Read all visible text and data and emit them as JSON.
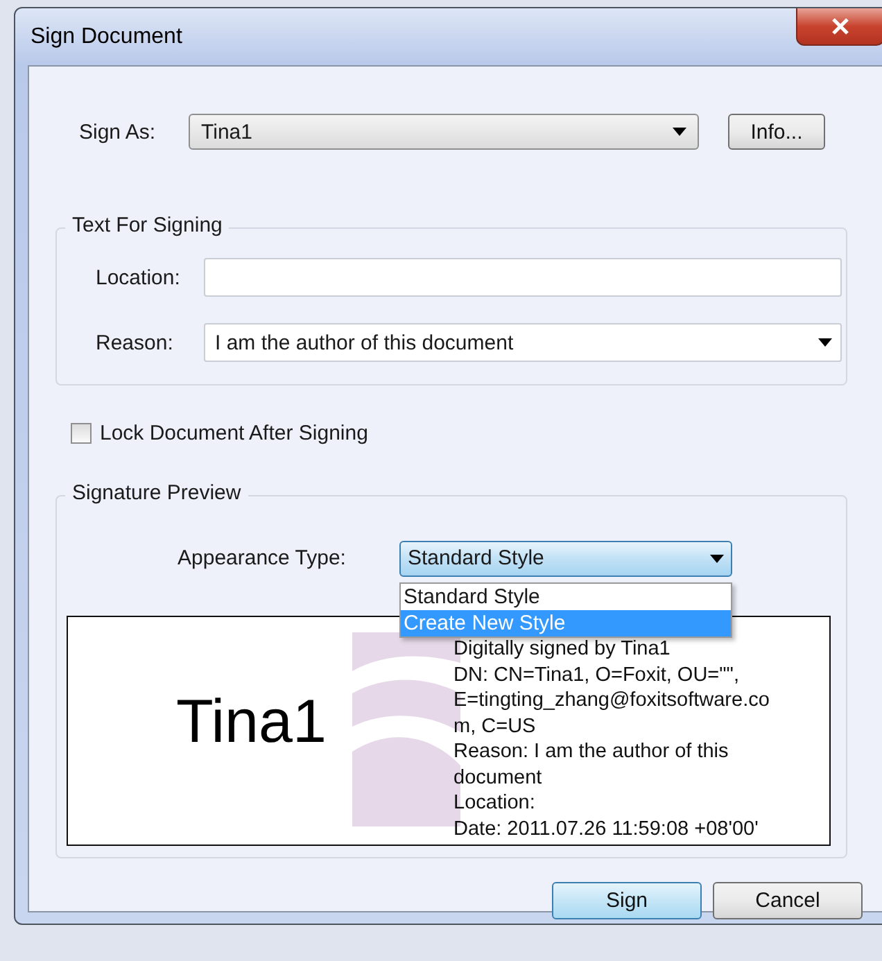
{
  "window": {
    "title": "Sign Document"
  },
  "sign_as": {
    "label": "Sign As:",
    "value": "Tina1",
    "info_button": "Info..."
  },
  "text_for_signing": {
    "title": "Text For Signing",
    "location": {
      "label": "Location:"
    },
    "reason": {
      "label": "Reason:",
      "value": "I am the author of this document"
    }
  },
  "lock_checkbox": {
    "label": "Lock Document After Signing",
    "checked": false
  },
  "signature_preview": {
    "title": "Signature Preview",
    "appearance_type": {
      "label": "Appearance Type:",
      "value": "Standard Style",
      "expanded": true,
      "options": [
        {
          "label": "Standard Style",
          "highlighted": false
        },
        {
          "label": "Create New Style",
          "highlighted": true
        }
      ]
    },
    "preview": {
      "name": "Tina1",
      "lines": [
        "Digitally signed by Tina1",
        "DN: CN=Tina1, O=Foxit, OU=\"\",",
        "E=tingting_zhang@foxitsoftware.co",
        "m, C=US",
        "Reason: I am the author of this",
        "document",
        "Location:",
        "Date: 2011.07.26 11:59:08 +08'00'"
      ]
    }
  },
  "buttons": [
    {
      "label": "Sign",
      "default": true
    },
    {
      "label": "Cancel",
      "default": false
    }
  ]
}
